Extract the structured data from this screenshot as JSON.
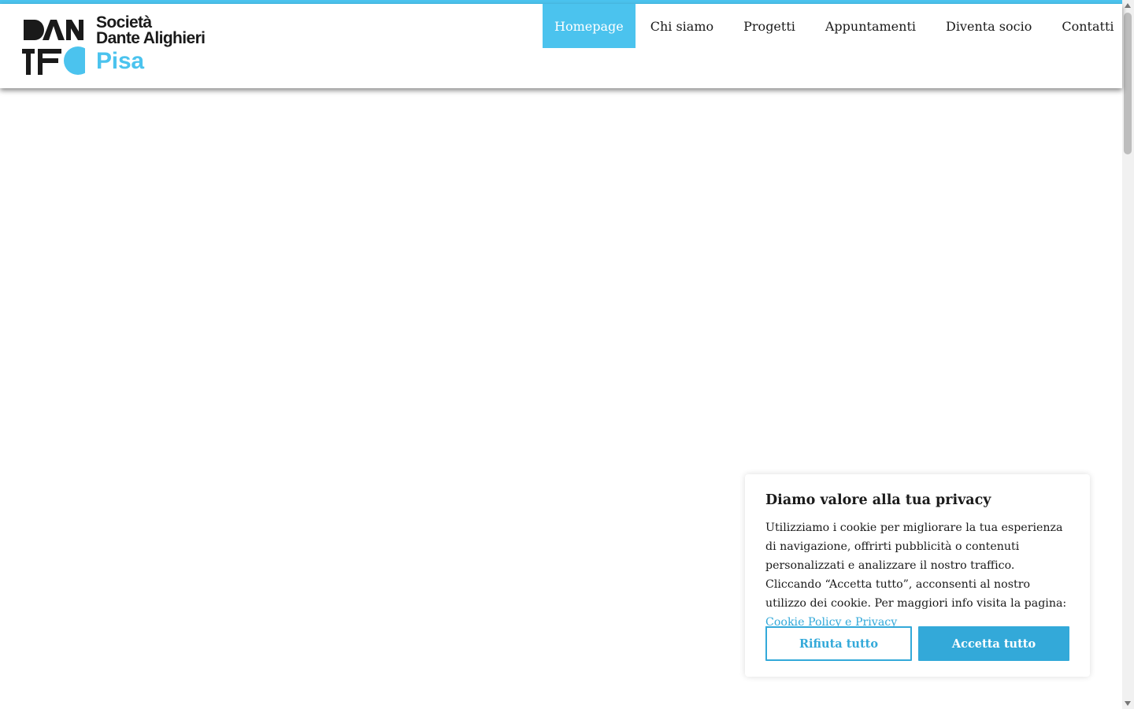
{
  "logo": {
    "line1": "Società",
    "line2": "Dante Alighieri",
    "city": "Pisa",
    "mark_letters": "DANTE"
  },
  "nav": {
    "items": [
      {
        "label": "Homepage",
        "active": true
      },
      {
        "label": "Chi siamo",
        "active": false
      },
      {
        "label": "Progetti",
        "active": false
      },
      {
        "label": "Appuntamenti",
        "active": false
      },
      {
        "label": "Diventa socio",
        "active": false
      },
      {
        "label": "Contatti",
        "active": false
      }
    ]
  },
  "cookie_banner": {
    "title": "Diamo valore alla tua privacy",
    "text": "Utilizziamo i cookie per migliorare la tua esperienza di navigazione, offrirti pubblicità o contenuti personalizzati e analizzare il nostro traffico. Cliccando “Accetta tutto”, acconsenti al nostro utilizzo dei cookie. Per maggiori info visita la pagina: ",
    "link_label": "Cookie Policy e Privacy",
    "reject_label": "Rifiuta tutto",
    "accept_label": "Accetta tutto"
  },
  "colors": {
    "accent": "#4bc3ee",
    "button": "#33a9d9",
    "text": "#1a1a1a"
  }
}
